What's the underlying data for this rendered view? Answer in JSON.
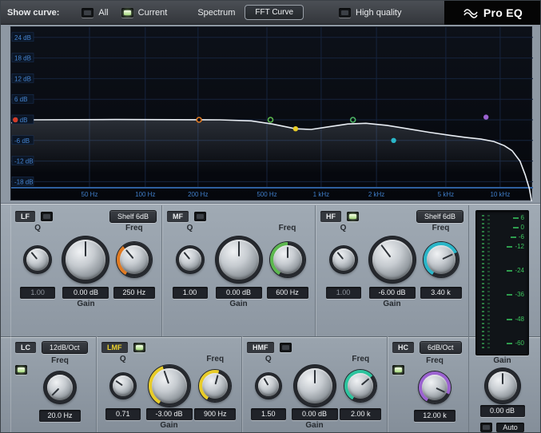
{
  "topbar": {
    "show_curve_label": "Show curve:",
    "all_label": "All",
    "current_label": "Current",
    "spectrum_label": "Spectrum",
    "fft_button_label": "FFT Curve",
    "high_quality_label": "High quality",
    "logo_text": "Pro EQ"
  },
  "graph": {
    "y_labels": [
      "24 dB",
      "18 dB",
      "12 dB",
      "6 dB",
      "0 dB",
      "-6 dB",
      "-12 dB",
      "-18 dB"
    ],
    "db_lines": [
      24,
      18,
      12,
      6,
      0,
      -6,
      -12,
      -18
    ],
    "x_labels": [
      "50 Hz",
      "100 Hz",
      "200 Hz",
      "500 Hz",
      "1 kHz",
      "2 kHz",
      "5 kHz",
      "10 kHz"
    ],
    "x_positions": [
      0.15,
      0.257,
      0.358,
      0.49,
      0.594,
      0.7,
      0.833,
      0.937
    ],
    "curve": [
      [
        0,
        -0.9
      ],
      [
        0.01,
        -0.4
      ],
      [
        0.03,
        0
      ],
      [
        0.2,
        0.1
      ],
      [
        0.4,
        0
      ],
      [
        0.46,
        -0.3
      ],
      [
        0.5,
        -1.2
      ],
      [
        0.545,
        -2.6
      ],
      [
        0.575,
        -2.8
      ],
      [
        0.61,
        -2.0
      ],
      [
        0.645,
        -1.2
      ],
      [
        0.68,
        -1.0
      ],
      [
        0.72,
        -1.6
      ],
      [
        0.76,
        -2.6
      ],
      [
        0.8,
        -3.6
      ],
      [
        0.84,
        -4.5
      ],
      [
        0.87,
        -5.1
      ],
      [
        0.9,
        -5.6
      ],
      [
        0.925,
        -6.3
      ],
      [
        0.945,
        -7.5
      ],
      [
        0.96,
        -9
      ],
      [
        0.975,
        -12
      ],
      [
        0.985,
        -16
      ],
      [
        0.993,
        -20
      ],
      [
        1,
        -26
      ]
    ],
    "markers": [
      {
        "band": "LC",
        "color": "#d23c28",
        "x": 0.008,
        "db": 0,
        "filled": true
      },
      {
        "band": "LF",
        "color": "#e07a22",
        "x": 0.36,
        "db": 0,
        "filled": false
      },
      {
        "band": "MF",
        "color": "#5cb84e",
        "x": 0.497,
        "db": 0,
        "filled": false
      },
      {
        "band": "LMF",
        "color": "#e8cc28",
        "x": 0.545,
        "db": -2.6,
        "filled": true
      },
      {
        "band": "HMF",
        "color": "#4cb464",
        "x": 0.655,
        "db": 0,
        "filled": false
      },
      {
        "band": "HF",
        "color": "#2ab6c8",
        "x": 0.733,
        "db": -6,
        "filled": true
      },
      {
        "band": "HC",
        "color": "#9b62d0",
        "x": 0.91,
        "db": 0.8,
        "filled": true
      }
    ]
  },
  "labels": {
    "q": "Q",
    "gain": "Gain",
    "freq": "Freq"
  },
  "bands": {
    "lf": {
      "name": "LF",
      "mode": "Shelf 6dB",
      "q": "1.00",
      "gain": "0.00 dB",
      "freq": "250 Hz"
    },
    "mf": {
      "name": "MF",
      "q": "1.00",
      "gain": "0.00 dB",
      "freq": "600 Hz"
    },
    "hf": {
      "name": "HF",
      "mode": "Shelf 6dB",
      "q": "1.00",
      "gain": "-6.00 dB",
      "freq": "3.40 k"
    },
    "lc": {
      "name": "LC",
      "mode": "12dB/Oct",
      "freq": "20.0 Hz"
    },
    "lmf": {
      "name": "LMF",
      "q": "0.71",
      "gain": "-3.00 dB",
      "freq": "900 Hz"
    },
    "hmf": {
      "name": "HMF",
      "q": "1.50",
      "gain": "0.00 dB",
      "freq": "2.00 k"
    },
    "hc": {
      "name": "HC",
      "mode": "6dB/Oct",
      "freq": "12.00 k"
    }
  },
  "output": {
    "gain_label": "Gain",
    "gain_value": "0.00 dB",
    "auto_label": "Auto"
  },
  "meter": {
    "scale": [
      "6",
      "0",
      "-6",
      "-12",
      "-24",
      "-36",
      "-48",
      "-60"
    ],
    "tops": [
      4,
      16,
      28,
      40,
      70,
      100,
      131,
      161
    ]
  },
  "colors": {
    "lf_accent": "#e07a22",
    "mf_accent": "#5cb84e",
    "hf_accent": "#2ab6c8",
    "lc_accent": "#d23c28",
    "lmf_accent": "#e8cc28",
    "hmf_accent": "#2cc49e",
    "hc_accent": "#9b62d0",
    "curve": "#e9eef4",
    "grid_label": "#3f7dc8",
    "meter_green": "#3cc45c"
  }
}
